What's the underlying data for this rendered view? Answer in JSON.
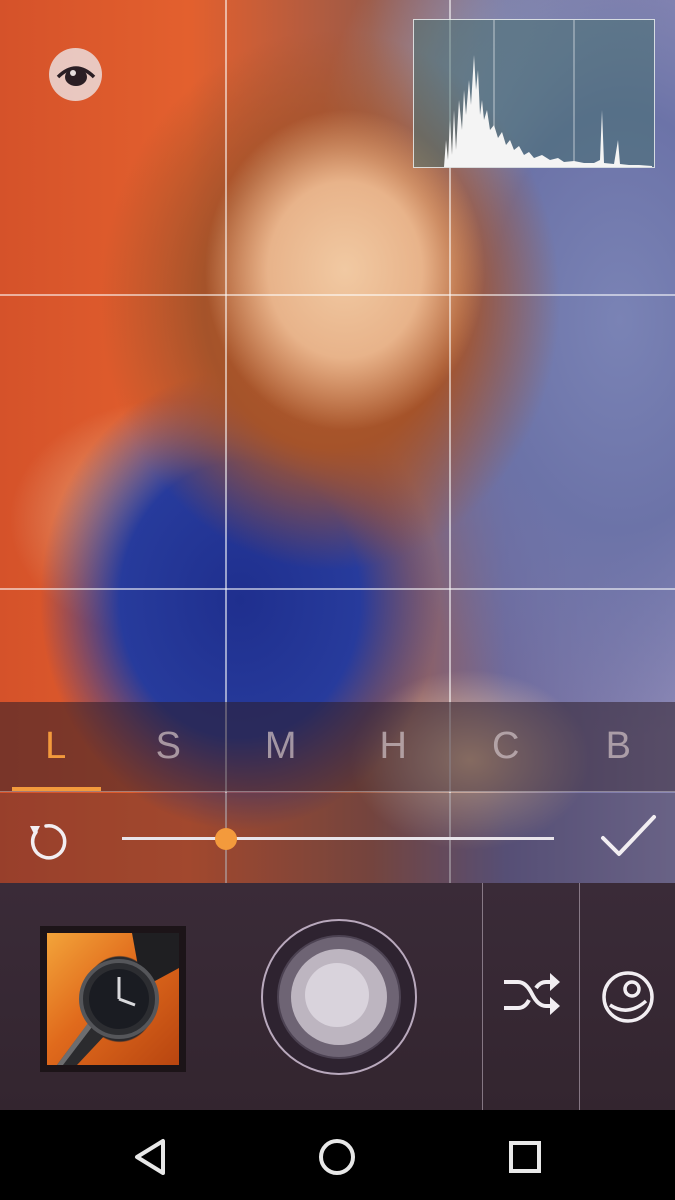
{
  "app": {
    "accent_color": "#f39a3c",
    "preview_image": "photo-girl-in-blue-dress"
  },
  "viewfinder": {
    "grid": "rule-of-thirds",
    "preview_toggle_icon": "eye-icon",
    "histogram_visible": true
  },
  "curve_tabs": {
    "active_index": 0,
    "items": [
      {
        "label": "L"
      },
      {
        "label": "S"
      },
      {
        "label": "M"
      },
      {
        "label": "H"
      },
      {
        "label": "C"
      },
      {
        "label": "B"
      }
    ]
  },
  "slider": {
    "reset_icon": "reset-icon",
    "value_fraction": 0.24,
    "confirm_icon": "checkmark-icon"
  },
  "controls": {
    "gallery_thumbnail": "last-photo-wristwatch",
    "shutter_icon": "shutter-button",
    "shuffle_icon": "shuffle-icon",
    "filter_icon": "lens-filter-icon"
  },
  "nav_bar": {
    "back_icon": "back-triangle-icon",
    "home_icon": "home-circle-icon",
    "recents_icon": "recents-square-icon"
  }
}
